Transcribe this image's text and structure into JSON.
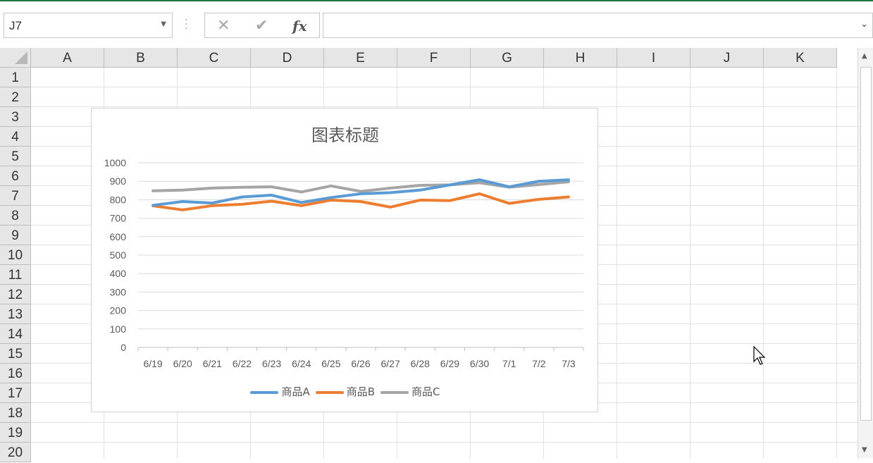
{
  "formula_bar": {
    "name_box_value": "J7",
    "cancel_symbol": "✕",
    "enter_symbol": "✔",
    "fx_symbol": "fx",
    "formula_value": ""
  },
  "columns": [
    "A",
    "B",
    "C",
    "D",
    "E",
    "F",
    "G",
    "H",
    "I",
    "J",
    "K"
  ],
  "rows": [
    "1",
    "2",
    "3",
    "4",
    "5",
    "6",
    "7",
    "8",
    "9",
    "10",
    "11",
    "12",
    "13",
    "14",
    "15",
    "16",
    "17",
    "18",
    "19",
    "20"
  ],
  "colors": {
    "series_a": "#5b9bd5",
    "series_b": "#ed7d31",
    "series_c": "#a5a5a5",
    "grid": "#d9d9d9",
    "header_bg": "#e6e6e6"
  },
  "chart_data": {
    "type": "line",
    "title": "图表标题",
    "categories": [
      "6/19",
      "6/20",
      "6/21",
      "6/22",
      "6/23",
      "6/24",
      "6/25",
      "6/26",
      "6/27",
      "6/28",
      "6/29",
      "6/30",
      "7/1",
      "7/2",
      "7/3"
    ],
    "y_ticks": [
      "0",
      "100",
      "200",
      "300",
      "400",
      "500",
      "600",
      "700",
      "800",
      "900",
      "1000"
    ],
    "ylim": [
      0,
      1000
    ],
    "grid": true,
    "legend_position": "bottom",
    "series": [
      {
        "name": "商品A",
        "values": [
          770,
          790,
          782,
          815,
          825,
          785,
          812,
          832,
          838,
          852,
          880,
          908,
          870,
          900,
          908
        ]
      },
      {
        "name": "商品B",
        "values": [
          767,
          745,
          768,
          775,
          792,
          768,
          798,
          790,
          760,
          798,
          795,
          832,
          780,
          802,
          815
        ]
      },
      {
        "name": "商品C",
        "values": [
          848,
          852,
          863,
          867,
          870,
          842,
          875,
          845,
          863,
          878,
          880,
          892,
          868,
          882,
          897
        ]
      }
    ]
  }
}
